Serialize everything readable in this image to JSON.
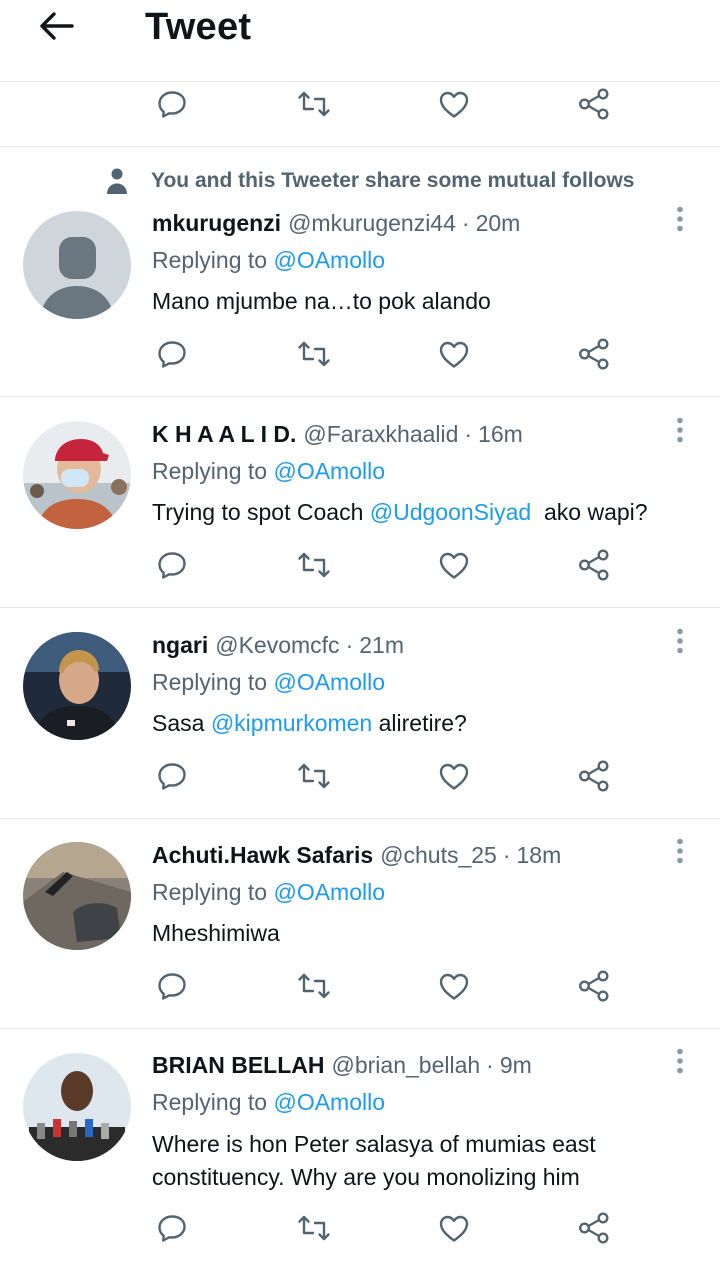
{
  "header": {
    "title": "Tweet",
    "back_icon": "arrow-left-icon"
  },
  "mutual_notice": {
    "text": "You and this Tweeter share some mutual follows",
    "icon": "person-icon"
  },
  "replying_prefix": "Replying to",
  "tweets": [
    {
      "name": "mkurugenzi",
      "handle": "@mkurugenzi44",
      "separator": "·",
      "time": "20m",
      "reply_to": "@OAmollo",
      "text_parts": [
        "Mano mjumbe na…to pok alando"
      ]
    },
    {
      "name": "K H A A L I D.",
      "handle": "@Faraxkhaalid",
      "separator": "·",
      "time": "16m",
      "reply_to": "@OAmollo",
      "text_parts": [
        "Trying to spot Coach ",
        "@UdgoonSiyad",
        "  ako wapi?"
      ]
    },
    {
      "name": "ngari",
      "handle": "@Kevomcfc",
      "separator": "·",
      "time": "21m",
      "reply_to": "@OAmollo",
      "text_parts": [
        "Sasa ",
        "@kipmurkomen",
        " aliretire?"
      ]
    },
    {
      "name": "Achuti.Hawk Safaris",
      "handle": "@chuts_25",
      "separator": "·",
      "time": "18m",
      "reply_to": "@OAmollo",
      "text_parts": [
        "Mheshimiwa"
      ]
    },
    {
      "name": "BRIAN BELLAH",
      "handle": "@brian_bellah",
      "separator": "·",
      "time": "9m",
      "reply_to": "@OAmollo",
      "text_parts": [
        "Where is hon Peter salasya of mumias east constituency. Why are you monolizing him"
      ]
    }
  ],
  "action_icons": [
    "reply-icon",
    "retweet-icon",
    "like-icon",
    "share-icon"
  ],
  "colors": {
    "text": "#0f1419",
    "secondary": "#536471",
    "link": "#1d9bf0",
    "divider": "#e6e9ec"
  }
}
